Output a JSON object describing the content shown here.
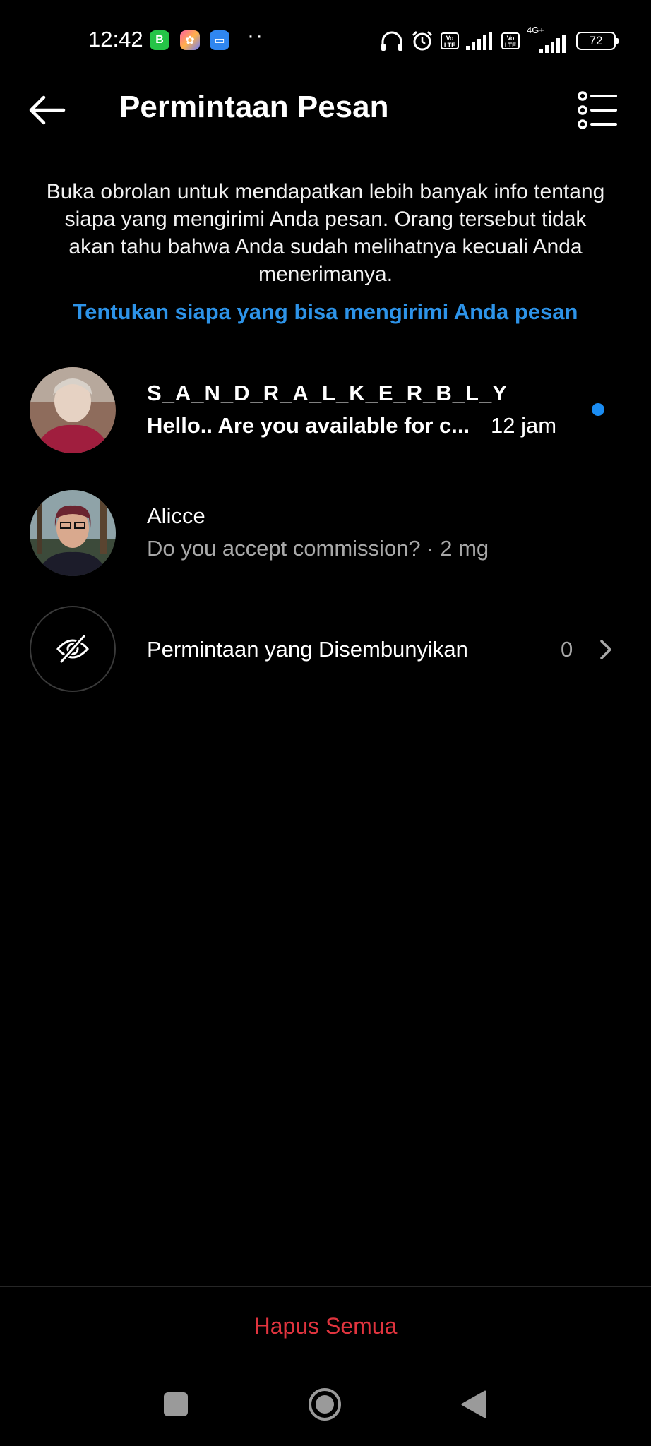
{
  "status_bar": {
    "time": "12:42",
    "network_label": "4G+",
    "volte_label": "Vo LTE",
    "battery": "72",
    "notification_icons": [
      "whatsapp-business-icon",
      "gallery-app-icon",
      "messages-app-icon"
    ],
    "system_icons": [
      "headphones-icon",
      "alarm-icon",
      "volte-icon",
      "signal-icon",
      "battery-icon"
    ]
  },
  "header": {
    "title": "Permintaan Pesan"
  },
  "info": {
    "text": "Buka obrolan untuk mendapatkan lebih banyak info tentang siapa yang mengirimi Anda pesan. Orang tersebut tidak akan tahu bahwa Anda sudah melihatnya kecuali Anda menerimanya.",
    "link": "Tentukan siapa yang bisa mengirimi Anda pesan"
  },
  "requests": [
    {
      "name": "S_A_N_D_R_A_L_K_E_R_B_L_Y",
      "message": "Hello.. Are you available for c...",
      "time": "12 jam",
      "unread": true
    },
    {
      "name": "Alicce",
      "message": "Do you accept commission? · 2 mg",
      "unread": false
    }
  ],
  "hidden_requests": {
    "label": "Permintaan yang Disembunyikan",
    "count": "0"
  },
  "footer": {
    "delete_all": "Hapus Semua"
  },
  "colors": {
    "background": "#000000",
    "link": "#2d93e8",
    "unread_dot": "#1a8cf2",
    "destructive": "#e0343e",
    "secondary_text": "#a8a8a8"
  }
}
